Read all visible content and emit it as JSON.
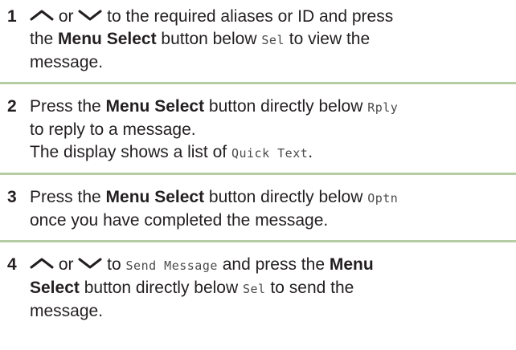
{
  "steps": [
    {
      "number": "1",
      "scroll_up_icon": "chevron-up-icon",
      "or_text": " or ",
      "scroll_down_icon": "chevron-down-icon",
      "text_a": " to the required aliases or ID and press",
      "the_text": "the ",
      "bold": "Menu Select",
      "text_b": " button below ",
      "lcd": "Sel",
      "text_c": " to view the",
      "text_d": "message."
    },
    {
      "number": "2",
      "text_a": "Press the ",
      "bold": "Menu Select",
      "text_b": " button directly below ",
      "lcd": "Rply",
      "text_c": "to reply to a message.",
      "text_d": "The display shows a list of ",
      "lcd2": "Quick Text",
      "text_e": "."
    },
    {
      "number": "3",
      "text_a": "Press the ",
      "bold": "Menu Select",
      "text_b": " button directly below ",
      "lcd": "Optn",
      "text_c": "once you have completed the message."
    },
    {
      "number": "4",
      "scroll_up_icon": "chevron-up-icon",
      "or_text": " or ",
      "scroll_down_icon": "chevron-down-icon",
      "text_a": " to ",
      "lcd": "Send Message",
      "text_b": " and press the ",
      "bold_a": "Menu",
      "bold_b": "Select",
      "text_c": " button directly below ",
      "lcd2": "Sel",
      "text_d": " to send the",
      "text_e": "message."
    }
  ],
  "colors": {
    "separator": "#b5cda2",
    "text": "#231f20",
    "lcd_text": "#4a4a4a"
  }
}
